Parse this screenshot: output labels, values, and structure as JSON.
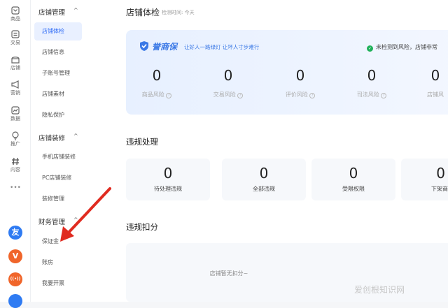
{
  "rail": {
    "items": [
      {
        "label": "商品",
        "icon": "shop-icon"
      },
      {
        "label": "交易",
        "icon": "transaction-icon"
      },
      {
        "label": "店铺",
        "icon": "store-icon"
      },
      {
        "label": "营销",
        "icon": "megaphone-icon"
      },
      {
        "label": "数据",
        "icon": "chart-icon"
      },
      {
        "label": "推广",
        "icon": "bulb-icon"
      },
      {
        "label": "内容",
        "icon": "hashtag-icon"
      }
    ],
    "more": "•••",
    "dock": [
      {
        "text": "友",
        "color": "#2f7bf2"
      },
      {
        "text": "V",
        "color": "#f0652a"
      },
      {
        "text": "((•))",
        "color": "#f0652a"
      },
      {
        "text": "",
        "color": "#2f7bf2"
      }
    ]
  },
  "sidebar": {
    "groups": [
      {
        "title": "店铺管理",
        "items": [
          "店铺体检",
          "店铺信息",
          "子账号管理",
          "店铺素材",
          "隐私保护"
        ]
      },
      {
        "title": "店铺装修",
        "items": [
          "手机店铺装修",
          "PC店铺装修",
          "装修管理"
        ]
      },
      {
        "title": "财务管理",
        "items": [
          "保证金",
          "账房",
          "我要开票"
        ]
      }
    ],
    "active": "店铺体检",
    "chevron": "^"
  },
  "page": {
    "title": "店铺体检",
    "checked_at": "检测时间: 今天"
  },
  "health": {
    "brand": "誉商保",
    "slogan": "让好人一路绿灯 让坏人寸步难行",
    "status": "未检测到风险，店铺非常",
    "metrics": [
      {
        "value": "0",
        "label": "商品风险"
      },
      {
        "value": "0",
        "label": "交易风险"
      },
      {
        "value": "0",
        "label": "评价风险"
      },
      {
        "value": "0",
        "label": "司法风险"
      },
      {
        "value": "0",
        "label": "店铺风"
      }
    ]
  },
  "violations": {
    "title": "违规处理",
    "cards": [
      {
        "value": "0",
        "label": "待处理违规"
      },
      {
        "value": "0",
        "label": "全部违规"
      },
      {
        "value": "0",
        "label": "受限权限"
      },
      {
        "value": "0",
        "label": "下架商"
      }
    ]
  },
  "deduction": {
    "title": "违规扣分",
    "empty_text": "店铺暂无扣分~"
  },
  "watermark": "爱创根知识网",
  "colors": {
    "accent": "#2e6bf6",
    "arrow": "#e02b20",
    "ok": "#21b15b"
  }
}
